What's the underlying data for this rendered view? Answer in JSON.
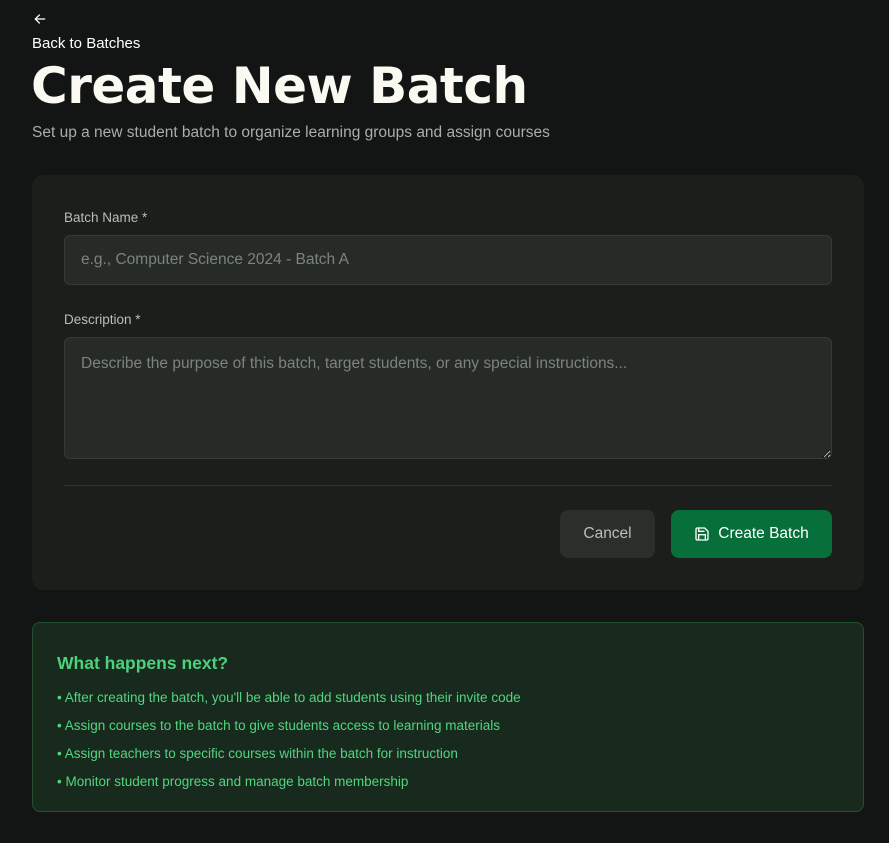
{
  "nav": {
    "back_icon": "arrow-left-icon",
    "back_label": "Back to Batches"
  },
  "header": {
    "title": "Create New Batch",
    "subtitle": "Set up a new student batch to organize learning groups and assign courses"
  },
  "form": {
    "batch_name": {
      "label": "Batch Name *",
      "value": "",
      "placeholder": "e.g., Computer Science 2024 - Batch A"
    },
    "description": {
      "label": "Description *",
      "value": "",
      "placeholder": "Describe the purpose of this batch, target students, or any special instructions..."
    },
    "cancel_label": "Cancel",
    "submit_label": "Create Batch",
    "submit_icon": "save-icon"
  },
  "info": {
    "title": "What happens next?",
    "items": [
      "• After creating the batch, you'll be able to add students using their invite code",
      "• Assign courses to the batch to give students access to learning materials",
      "• Assign teachers to specific courses within the batch for instruction",
      "• Monitor student progress and manage batch membership"
    ]
  },
  "colors": {
    "background": "#131514",
    "card": "#1b1e1b",
    "primary_button": "#07703a",
    "info_accent": "#4ed17c"
  }
}
